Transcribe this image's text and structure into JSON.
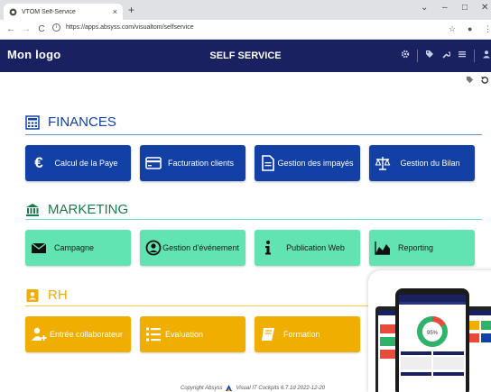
{
  "browser": {
    "tab_title": "VTOM Self-Service",
    "tab_close": "×",
    "new_tab": "+",
    "url": "https://apps.absyss.com/visualtom/selfservice",
    "controls": {
      "minimize": "–",
      "maximize": "□",
      "close": "✕",
      "chevron": "⌄"
    },
    "nav": {
      "back": "←",
      "forward": "→",
      "reload": "C"
    },
    "addr_icons": {
      "star": "☆",
      "profile": "●",
      "menu": "⋮"
    }
  },
  "header": {
    "logo": "Mon logo",
    "title": "SELF SERVICE",
    "icons": [
      "gear-icon",
      "tag-icon",
      "wrench-icon",
      "list-icon",
      "user-icon"
    ]
  },
  "sections": {
    "finances": {
      "title": "FINANCES",
      "color": "#1240a4",
      "tiles": [
        {
          "label": "Calcul de la Paye",
          "icon": "euro-icon"
        },
        {
          "label": "Facturation clients",
          "icon": "card-icon"
        },
        {
          "label": "Gestion des impayés",
          "icon": "document-icon"
        },
        {
          "label": "Gestion du Bilan",
          "icon": "scale-icon"
        }
      ]
    },
    "marketing": {
      "title": "MARKETING",
      "color": "#1d7a4f",
      "tiles": [
        {
          "label": "Campagne",
          "icon": "envelope-icon"
        },
        {
          "label": "Gestion d'événement",
          "icon": "person-icon"
        },
        {
          "label": "Publication Web",
          "icon": "info-icon"
        },
        {
          "label": "Reporting",
          "icon": "area-chart-icon"
        }
      ]
    },
    "rh": {
      "title": "RH",
      "color": "#f0ae00",
      "tiles": [
        {
          "label": "Entrée collaborateur",
          "icon": "add-user-icon"
        },
        {
          "label": "Evaluation",
          "icon": "ordered-list-icon"
        },
        {
          "label": "Formation",
          "icon": "book-icon"
        }
      ]
    }
  },
  "promo": {
    "percent": "95%"
  },
  "footer": {
    "text": "Copyright Absyss",
    "version": "Visual IT Cockpits 6.7.1d 2022-12-20"
  }
}
